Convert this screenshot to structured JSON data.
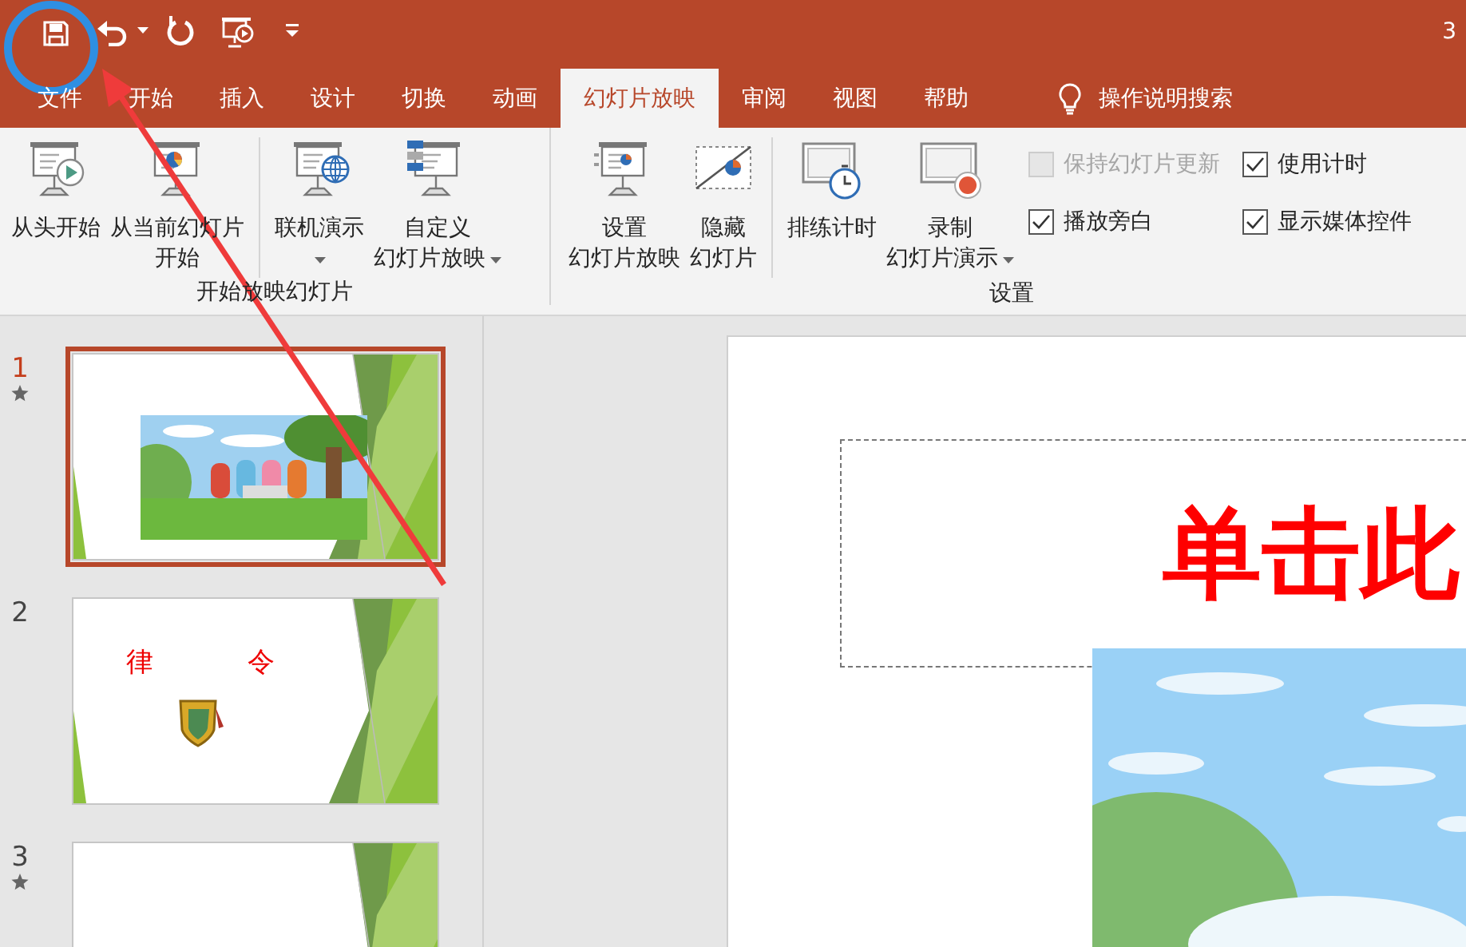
{
  "title_bar": {
    "title_fragment": "3"
  },
  "tabs": [
    {
      "label": "文件",
      "selected": false
    },
    {
      "label": "开始",
      "selected": false
    },
    {
      "label": "插入",
      "selected": false
    },
    {
      "label": "设计",
      "selected": false
    },
    {
      "label": "切换",
      "selected": false
    },
    {
      "label": "动画",
      "selected": false
    },
    {
      "label": "幻灯片放映",
      "selected": true
    },
    {
      "label": "审阅",
      "selected": false
    },
    {
      "label": "视图",
      "selected": false
    },
    {
      "label": "帮助",
      "selected": false
    }
  ],
  "tell_me": {
    "label": "操作说明搜索"
  },
  "ribbon_groups": [
    {
      "label": "开始放映幻灯片",
      "items": [
        {
          "kind": "command",
          "lines": [
            "从头开始"
          ],
          "dropdown": false
        },
        {
          "kind": "command",
          "lines": [
            "从当前幻灯片",
            "开始"
          ],
          "dropdown": false
        },
        {
          "kind": "separator"
        },
        {
          "kind": "command",
          "lines": [
            "联机演示"
          ],
          "dropdown": true
        },
        {
          "kind": "command",
          "lines": [
            "自定义",
            "幻灯片放映"
          ],
          "dropdown": true
        }
      ]
    },
    {
      "label": "设置",
      "items": [
        {
          "kind": "command",
          "lines": [
            "设置",
            "幻灯片放映"
          ],
          "dropdown": false
        },
        {
          "kind": "command",
          "lines": [
            "隐藏",
            "幻灯片"
          ],
          "dropdown": false
        },
        {
          "kind": "separator"
        },
        {
          "kind": "command",
          "lines": [
            "排练计时"
          ],
          "dropdown": false
        },
        {
          "kind": "command",
          "lines": [
            "录制",
            "幻灯片演示"
          ],
          "dropdown": true
        },
        {
          "kind": "checkbox_column",
          "options": [
            {
              "label": "保持幻灯片更新",
              "checked": false,
              "disabled": true
            },
            {
              "label": "播放旁白",
              "checked": true,
              "disabled": false
            }
          ]
        },
        {
          "kind": "checkbox_column",
          "options": [
            {
              "label": "使用计时",
              "checked": true,
              "disabled": false
            },
            {
              "label": "显示媒体控件",
              "checked": true,
              "disabled": false
            }
          ]
        }
      ]
    }
  ],
  "slides": [
    {
      "number": "1",
      "selected": true,
      "animated": true
    },
    {
      "number": "2",
      "selected": false,
      "animated": false,
      "content": {
        "kind": "text_and_emblem",
        "texts": [
          "律",
          "令"
        ]
      }
    },
    {
      "number": "3",
      "selected": false,
      "animated": true,
      "content": {
        "kind": "blank"
      }
    }
  ],
  "editor": {
    "title_placeholder": "单击此"
  }
}
